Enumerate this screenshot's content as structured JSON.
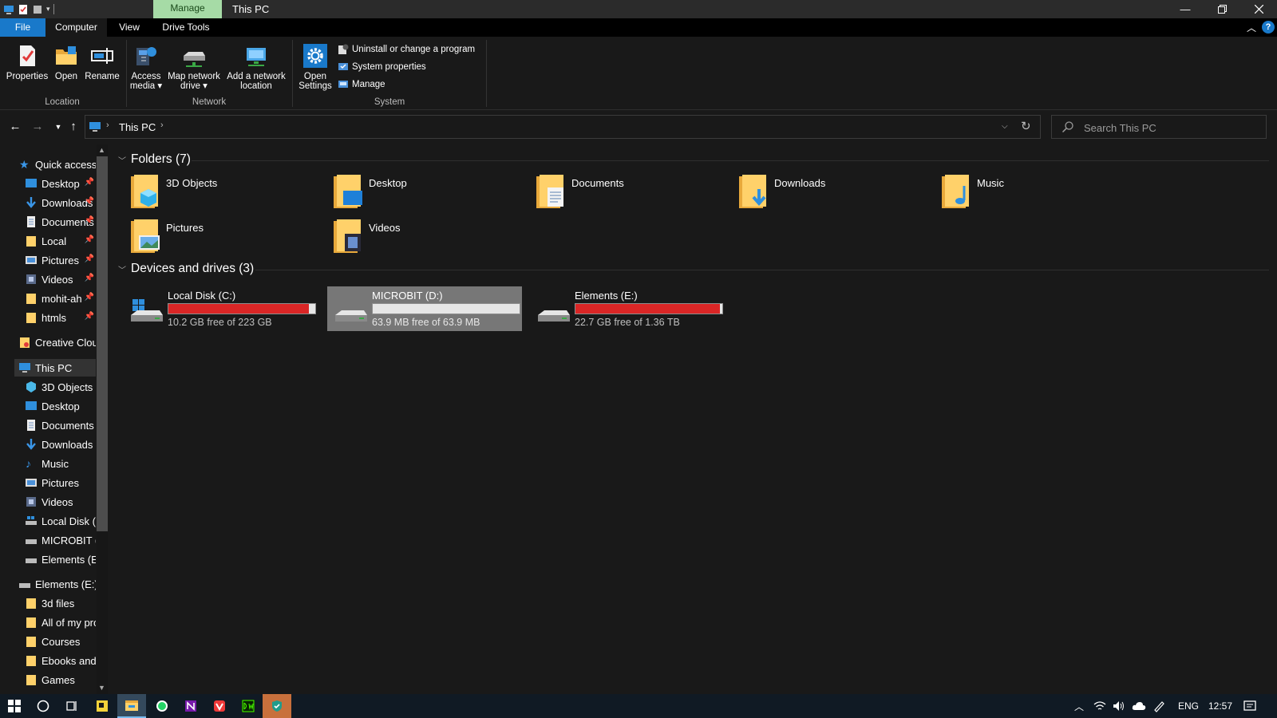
{
  "window": {
    "title": "This PC",
    "context_tab": "Manage"
  },
  "ribbon_tabs": [
    "File",
    "Computer",
    "View",
    "Drive Tools"
  ],
  "ribbon": {
    "location": {
      "label": "Location",
      "properties": "Properties",
      "open": "Open",
      "rename": "Rename"
    },
    "network": {
      "label": "Network",
      "access_media": [
        "Access",
        "media ▾"
      ],
      "map_drive": [
        "Map network",
        "drive ▾"
      ],
      "add_location": [
        "Add a network",
        "location"
      ]
    },
    "system": {
      "label": "System",
      "open_settings": [
        "Open",
        "Settings"
      ],
      "uninstall": "Uninstall or change a program",
      "system_properties": "System properties",
      "manage": "Manage"
    }
  },
  "address": {
    "crumb": "This PC",
    "search_placeholder": "Search This PC"
  },
  "sidebar": {
    "quick_access": "Quick access",
    "quick_items": [
      "Desktop",
      "Downloads",
      "Documents",
      "Local",
      "Pictures",
      "Videos",
      "mohit-ah",
      "htmls"
    ],
    "creative_cloud": "Creative Cloud Files",
    "this_pc": "This PC",
    "pc_items": [
      "3D Objects",
      "Desktop",
      "Documents",
      "Downloads",
      "Music",
      "Pictures",
      "Videos",
      "Local Disk (C:)",
      "MICROBIT (D:)",
      "Elements (E:)"
    ],
    "elements": "Elements (E:)",
    "elements_items": [
      "3d files",
      "All of my projects",
      "Courses",
      "Ebooks and",
      "Games"
    ]
  },
  "content": {
    "folders_header": "Folders (7)",
    "folders": [
      "3D Objects",
      "Desktop",
      "Documents",
      "Downloads",
      "Music",
      "Pictures",
      "Videos"
    ],
    "drives_header": "Devices and drives (3)",
    "drives": [
      {
        "name": "Local Disk (C:)",
        "free": "10.2 GB free of 223 GB",
        "used_fraction": 0.954
      },
      {
        "name": "MICROBIT (D:)",
        "free": "63.9 MB free of 63.9 MB",
        "used_fraction": 0.0
      },
      {
        "name": "Elements (E:)",
        "free": "22.7 GB free of 1.36 TB",
        "used_fraction": 0.984
      }
    ]
  },
  "taskbar": {
    "language": "ENG",
    "time": "12:57"
  },
  "colors": {
    "accent": "#1979ca",
    "drive_bar_full": "#da2626",
    "context_tab": "#a6dba6"
  }
}
